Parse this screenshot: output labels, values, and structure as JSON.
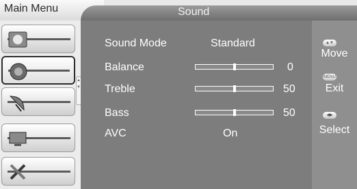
{
  "header": {
    "main_tab": "Main Menu",
    "current_tab": "Sound"
  },
  "sidebar": {
    "items": [
      {
        "name": "picture",
        "icon": "picture-icon"
      },
      {
        "name": "sound",
        "icon": "speaker-icon",
        "active": true
      },
      {
        "name": "channel",
        "icon": "satellite-dish-icon"
      },
      {
        "name": "feature",
        "icon": "screen-icon"
      },
      {
        "name": "setup",
        "icon": "tools-icon"
      }
    ]
  },
  "settings": {
    "sound_mode": {
      "label": "Sound Mode",
      "value": "Standard"
    },
    "balance": {
      "label": "Balance",
      "value": "0",
      "level": 0.5
    },
    "treble": {
      "label": "Treble",
      "value": "50",
      "level": 0.5
    },
    "bass": {
      "label": "Bass",
      "value": "50",
      "level": 0.5
    },
    "avc": {
      "label": "AVC",
      "value": "On"
    }
  },
  "hints": {
    "move": {
      "key": "▲▼",
      "label": "Move"
    },
    "exit": {
      "key": "MENU",
      "label": "Exit"
    },
    "select": {
      "key": "◀▶",
      "label": "Select"
    }
  },
  "colors": {
    "panel": "#7d7d7d",
    "text": "#ffffff"
  }
}
